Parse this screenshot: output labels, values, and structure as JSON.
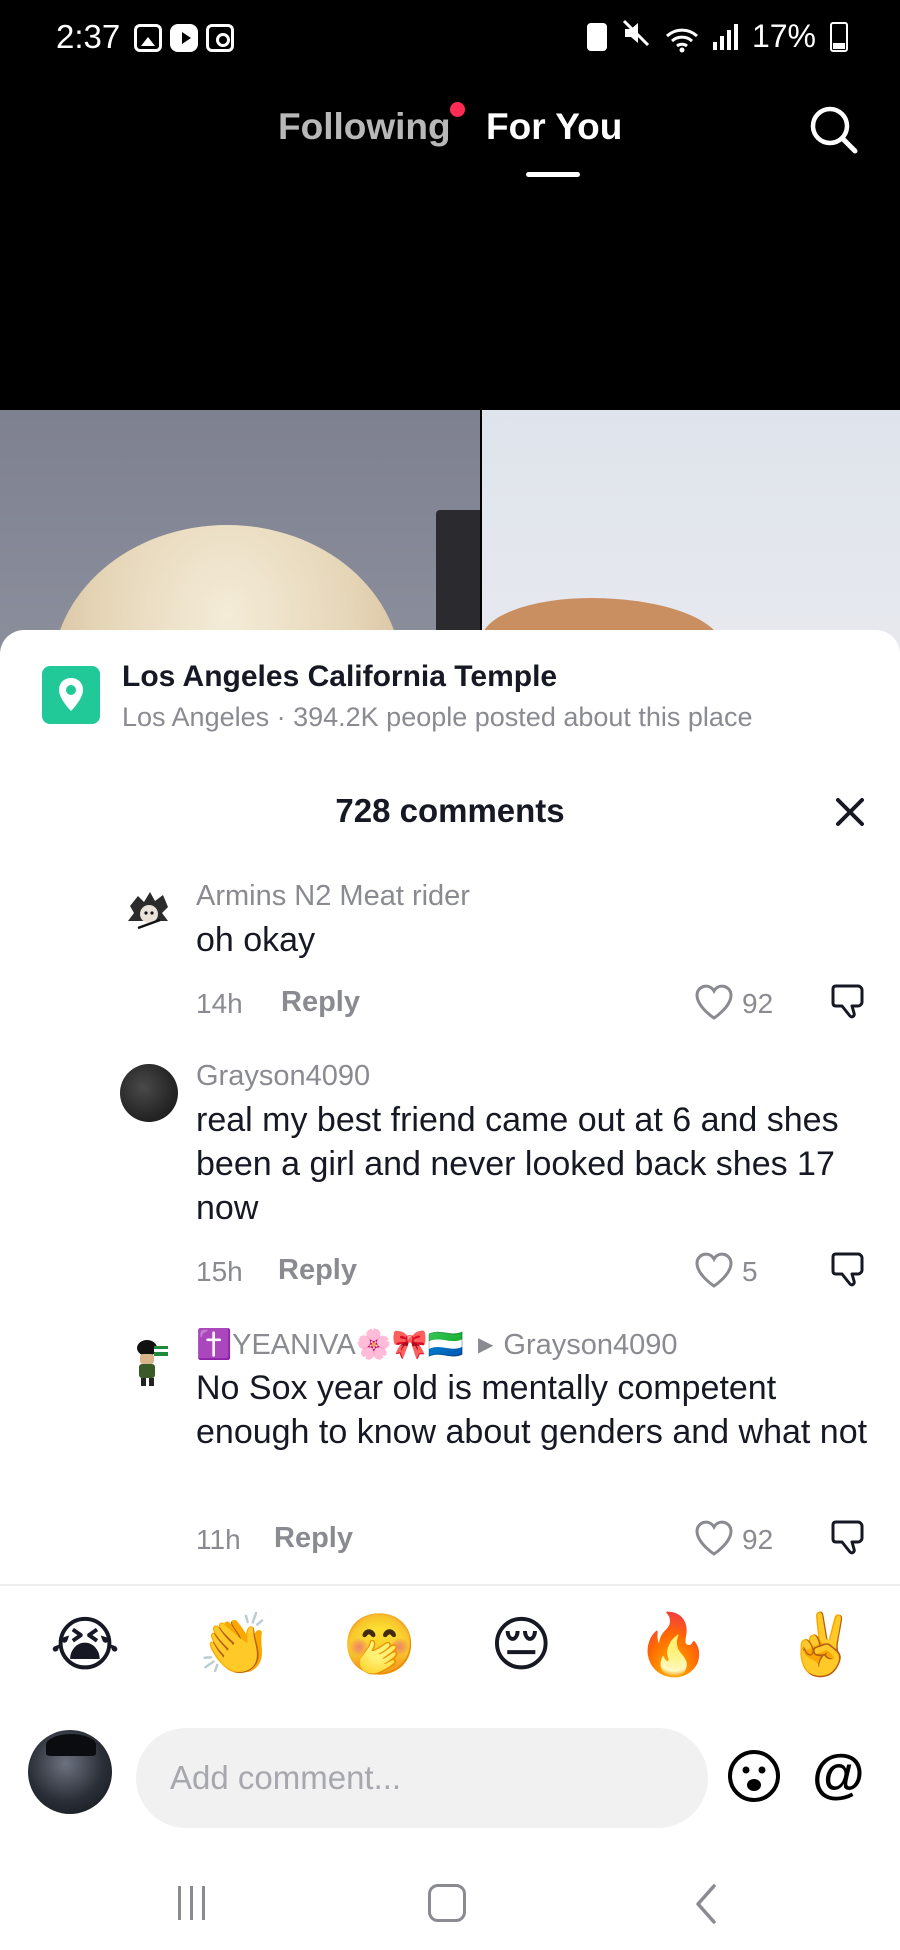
{
  "status_bar": {
    "time": "2:37",
    "battery": "17%",
    "notification_icons": [
      "gallery-icon",
      "youtube-icon",
      "camera-icon"
    ],
    "system_icons": [
      "battery-saver-icon",
      "mute-icon",
      "wifi-icon",
      "signal-icon",
      "battery-icon"
    ]
  },
  "nav": {
    "following_label": "Following",
    "for_you_label": "For You",
    "accent_color": "#fe2c55"
  },
  "location": {
    "title": "Los Angeles California Temple",
    "subtitle": "Los Angeles · 394.2K people posted about this place",
    "icon_color": "#20c997"
  },
  "comments_header": {
    "title": "728 comments"
  },
  "comments": [
    {
      "user": "Armins N2 Meat rider",
      "text": "oh okay",
      "time": "14h",
      "reply_label": "Reply",
      "likes": "92"
    },
    {
      "user": "Grayson4090",
      "text": "real my best friend came out at 6 and shes been a girl and never looked back shes 17 now",
      "time": "15h",
      "reply_label": "Reply",
      "likes": "5"
    },
    {
      "user": "✝️YEANIVA🌸🎀🇸🇱",
      "reply_to": "Grayson4090",
      "text": "No Sox year old is mentally competent enough to know about genders and what not",
      "time": "11h",
      "reply_label": "Reply",
      "likes": "92"
    }
  ],
  "emoji_bar": [
    "😭",
    "👏",
    "🤭",
    "😔",
    "🔥",
    "✌️"
  ],
  "composer": {
    "placeholder": "Add comment...",
    "mention_symbol": "@"
  }
}
